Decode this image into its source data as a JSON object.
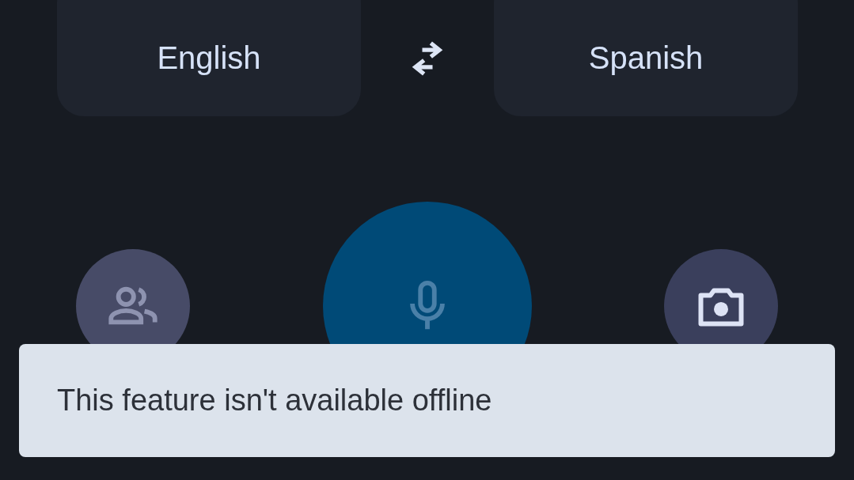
{
  "languages": [
    {
      "label": "English"
    },
    {
      "label": "Spanish"
    }
  ],
  "actions": [
    {
      "kind": "conversation",
      "disabled": true
    },
    {
      "kind": "voice",
      "disabled": true
    },
    {
      "kind": "camera",
      "disabled": false
    }
  ],
  "snackbar": {
    "message": "This feature isn't available offline"
  }
}
